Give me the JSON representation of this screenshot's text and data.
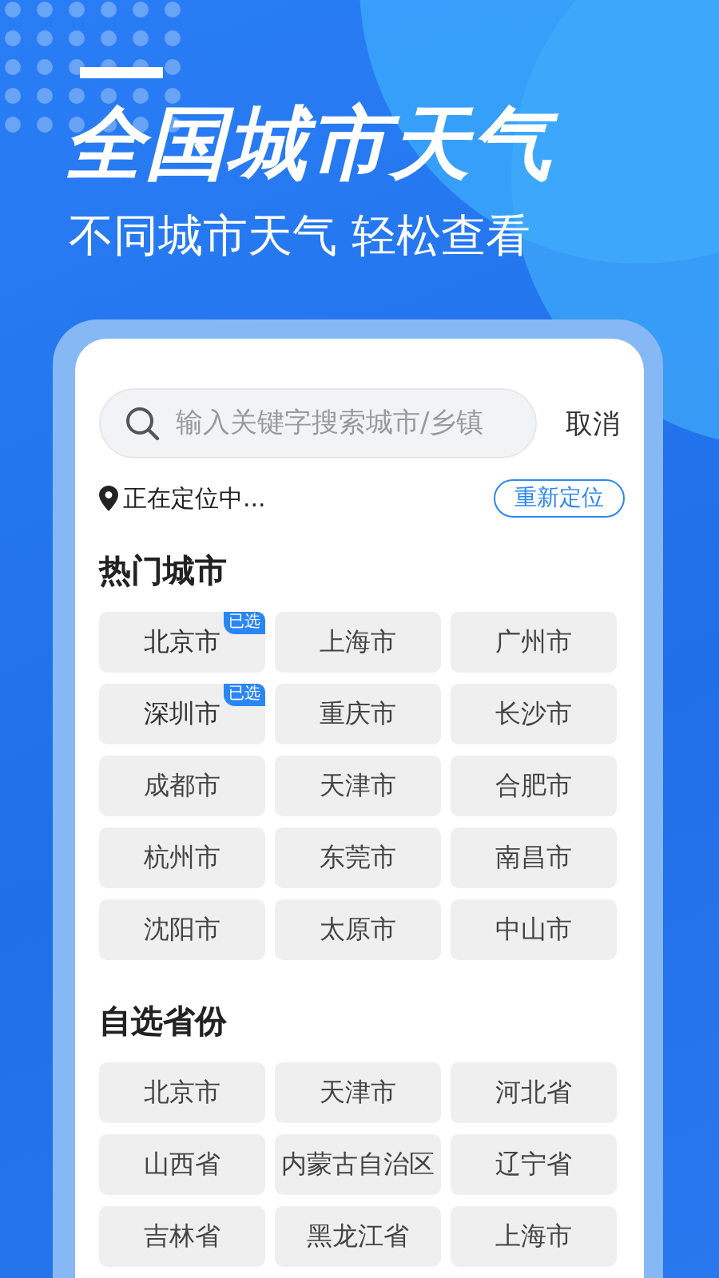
{
  "header": {
    "title": "全国城市天气",
    "subtitle": "不同城市天气 轻松查看"
  },
  "search": {
    "placeholder": "输入关键字搜索城市/乡镇",
    "cancel": "取消"
  },
  "location": {
    "status": "正在定位中...",
    "relocate": "重新定位"
  },
  "sections": [
    {
      "heading": "热门城市",
      "cities": [
        {
          "name": "北京市",
          "selected": true,
          "badge": "已选"
        },
        {
          "name": "上海市",
          "selected": false
        },
        {
          "name": "广州市",
          "selected": false
        },
        {
          "name": "深圳市",
          "selected": true,
          "badge": "已选"
        },
        {
          "name": "重庆市",
          "selected": false
        },
        {
          "name": "长沙市",
          "selected": false
        },
        {
          "name": "成都市",
          "selected": false
        },
        {
          "name": "天津市",
          "selected": false
        },
        {
          "name": "合肥市",
          "selected": false
        },
        {
          "name": "杭州市",
          "selected": false
        },
        {
          "name": "东莞市",
          "selected": false
        },
        {
          "name": "南昌市",
          "selected": false
        },
        {
          "name": "沈阳市",
          "selected": false
        },
        {
          "name": "太原市",
          "selected": false
        },
        {
          "name": "中山市",
          "selected": false
        }
      ]
    },
    {
      "heading": "自选省份",
      "cities": [
        {
          "name": "北京市",
          "selected": false
        },
        {
          "name": "天津市",
          "selected": false
        },
        {
          "name": "河北省",
          "selected": false
        },
        {
          "name": "山西省",
          "selected": false
        },
        {
          "name": "内蒙古自治区",
          "selected": false
        },
        {
          "name": "辽宁省",
          "selected": false
        },
        {
          "name": "吉林省",
          "selected": false
        },
        {
          "name": "黑龙江省",
          "selected": false
        },
        {
          "name": "上海市",
          "selected": false
        }
      ]
    }
  ]
}
